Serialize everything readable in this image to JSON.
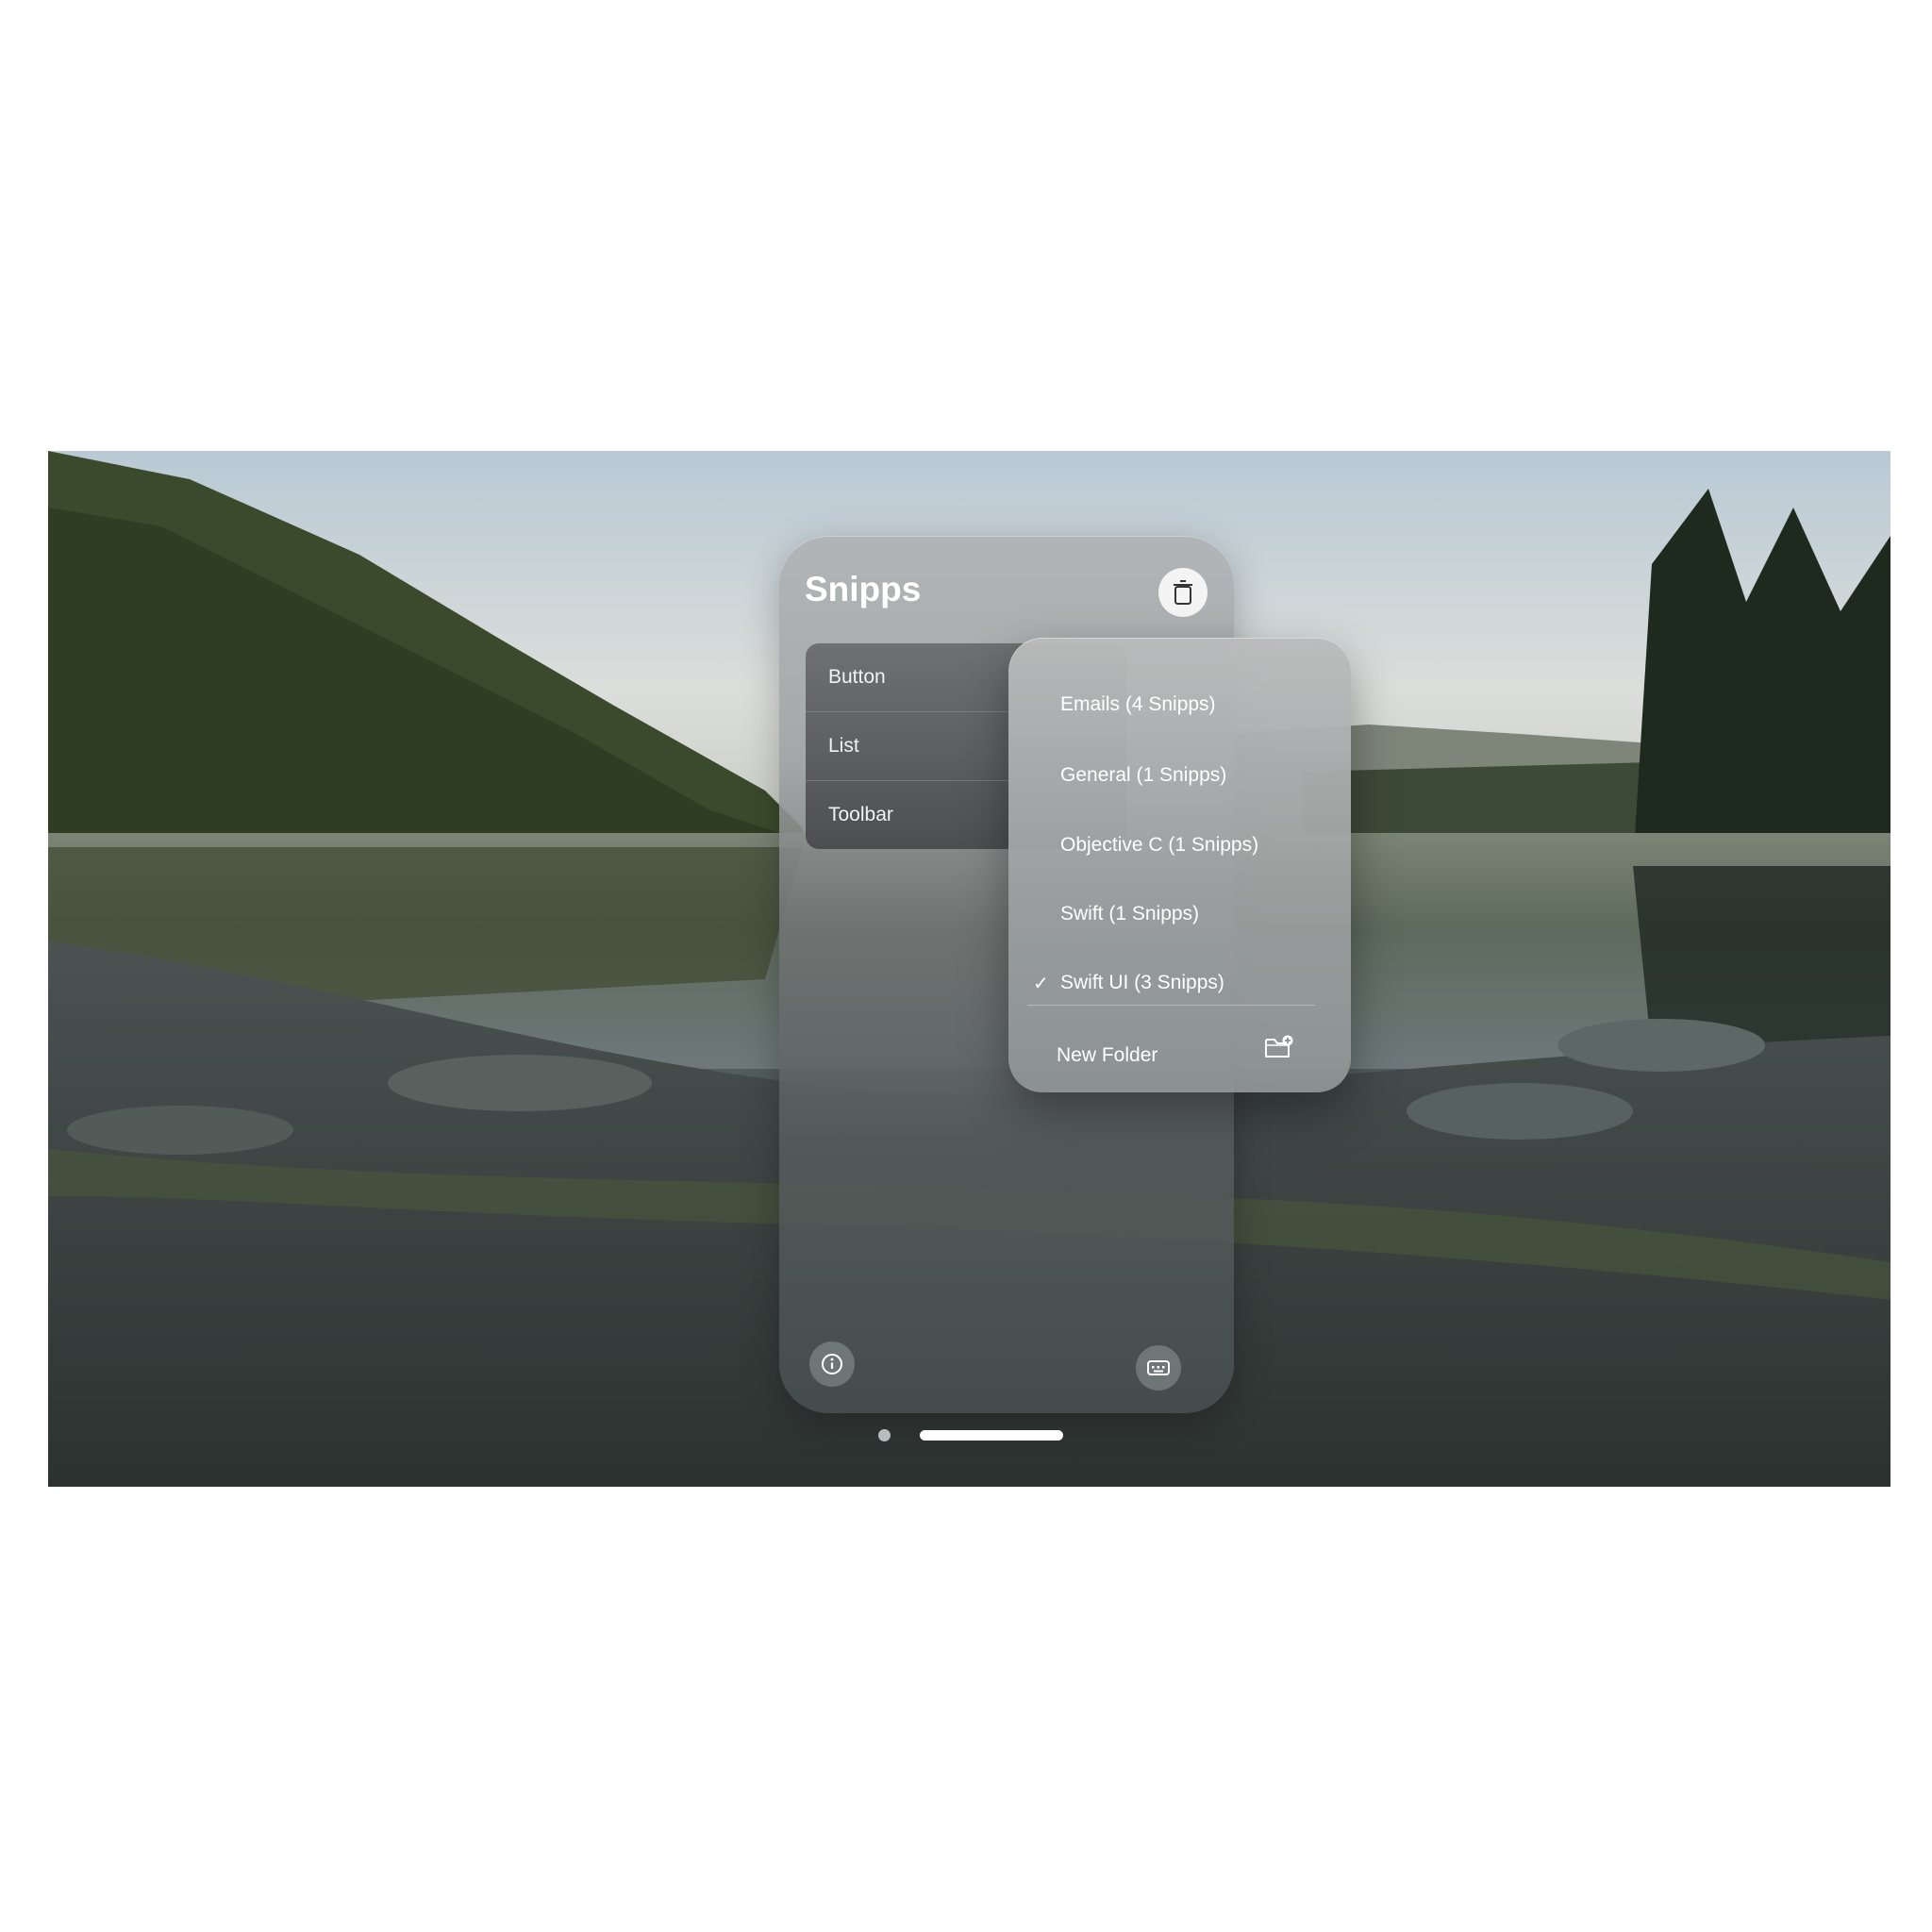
{
  "window": {
    "title": "Snipps",
    "list_items": [
      "Button",
      "List",
      "Toolbar"
    ]
  },
  "menu": {
    "items": [
      {
        "label": "Emails (4 Snipps)",
        "checked": false
      },
      {
        "label": "General (1 Snipps)",
        "checked": false
      },
      {
        "label": "Objective C (1 Snipps)",
        "checked": false
      },
      {
        "label": "Swift (1 Snipps)",
        "checked": false
      },
      {
        "label": "Swift UI (3 Snipps)",
        "checked": true
      }
    ],
    "check_mark": "✓",
    "new_folder_label": "New Folder"
  },
  "icons": {
    "trash": "trash-icon",
    "info": "info-icon",
    "keyboard": "keyboard-icon",
    "new_folder": "folder-add-icon"
  },
  "pager": {
    "pages": 2,
    "current": 2
  }
}
